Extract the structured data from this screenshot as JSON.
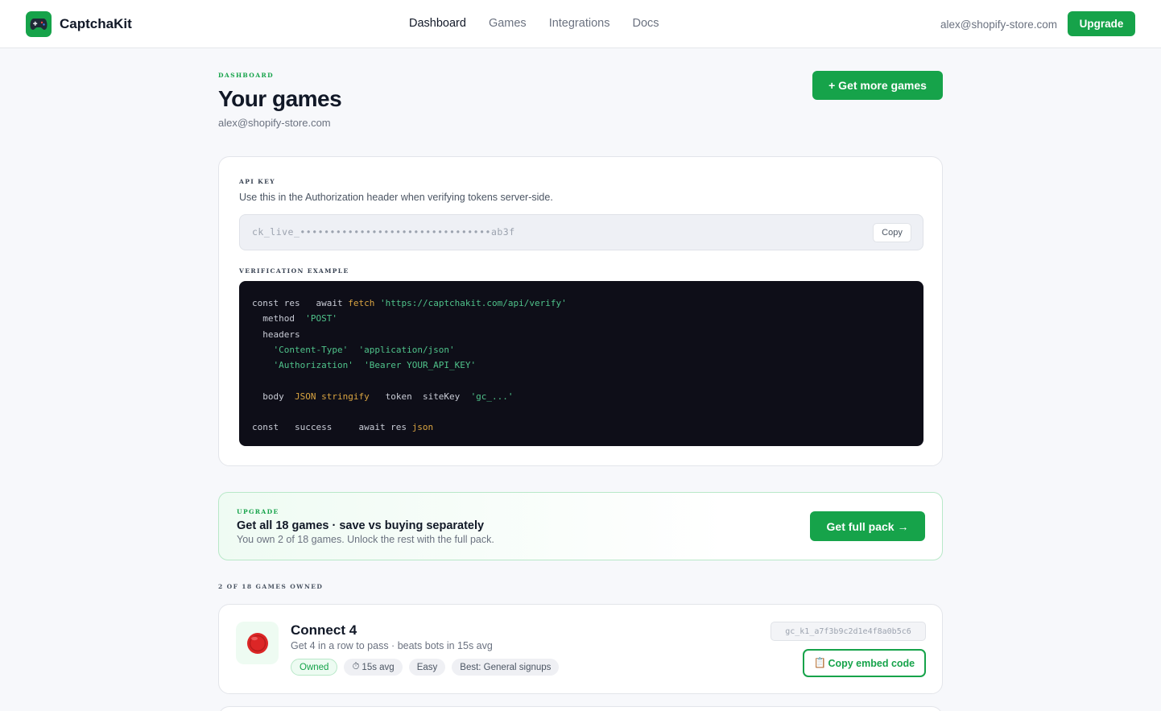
{
  "brand": {
    "name": "CaptchaKit",
    "logo_icon": "gamepad-icon"
  },
  "nav": {
    "items": [
      "Dashboard",
      "Games",
      "Integrations",
      "Docs"
    ],
    "active": "Dashboard"
  },
  "account": {
    "email": "alex@shopify-store.com",
    "upgrade_label": "Upgrade"
  },
  "header": {
    "eyebrow": "DASHBOARD",
    "title": "Your games",
    "subtitle": "alex@shopify-store.com",
    "more_games_label": "+ Get more games"
  },
  "api": {
    "eyebrow": "API KEY",
    "description": "Use this in the Authorization header when verifying tokens server-side.",
    "key_masked": "ck_live_••••••••••••••••••••••••••••••••ab3f",
    "copy_label": "Copy",
    "verification_eyebrow": "VERIFICATION EXAMPLE",
    "code": {
      "l1": [
        "const res   await ",
        "fetch",
        " ",
        "'https://captchakit.com/api/verify'"
      ],
      "l2": [
        "  method  ",
        "'POST'"
      ],
      "l3": [
        "  headers"
      ],
      "l4": [
        "    ",
        "'Content-Type'",
        "  ",
        "'application/json'"
      ],
      "l5": [
        "    ",
        "'Authorization'",
        "  ",
        "'Bearer YOUR_API_KEY'"
      ],
      "l6": [
        ""
      ],
      "l7": [
        "  body  ",
        "JSON",
        " ",
        "stringify",
        "   token  siteKey  ",
        "'gc_...'"
      ],
      "l8": [
        ""
      ],
      "l9": [
        "const   success     await res ",
        "json"
      ]
    }
  },
  "upgrade_banner": {
    "eyebrow": "UPGRADE",
    "title": "Get all 18 games · save vs buying separately",
    "subtitle": "You own 2 of 18 games. Unlock the rest with the full pack.",
    "button_label": "Get full pack →"
  },
  "owned": {
    "eyebrow": "2 OF 18 GAMES OWNED",
    "games": [
      {
        "title": "Connect 4",
        "description": "Get 4 in a row to pass · beats bots in 15s avg",
        "icon": "red-disc-icon",
        "tags": [
          "Owned",
          "15s avg",
          "Easy",
          "Best: General signups"
        ],
        "site_key": "gc_k1_a7f3b9c2d1e4f8a0b5c6",
        "embed_label": "Copy embed code"
      }
    ]
  },
  "colors": {
    "accent": "#16a34a",
    "code_bg": "#0e0e18",
    "code_string": "#4fc28a",
    "code_fn": "#d9a441"
  }
}
